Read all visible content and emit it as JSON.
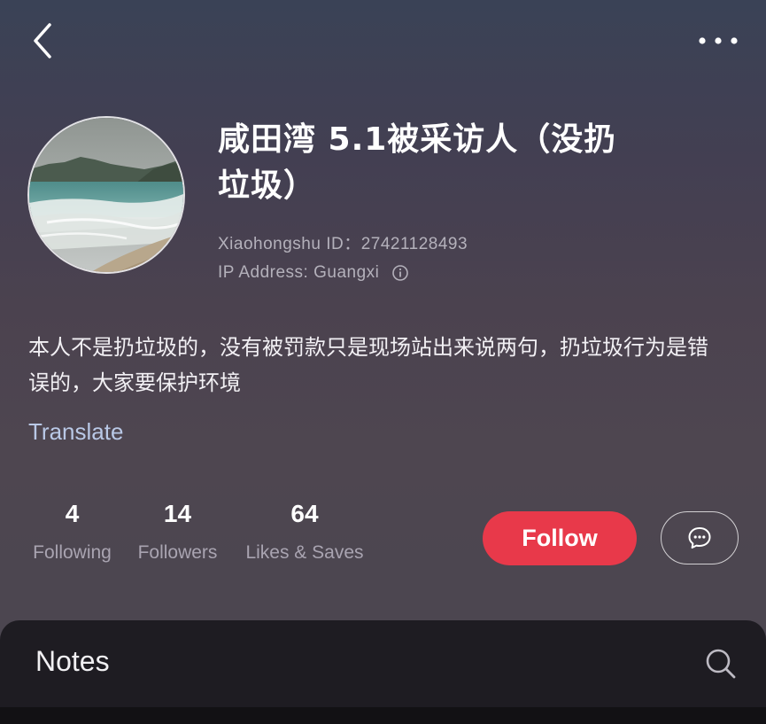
{
  "header": {
    "back_icon": "chevron-left-icon",
    "more_icon": "more-horizontal-icon"
  },
  "profile": {
    "name": "咸田湾 5.1被采访人（没扔垃圾）",
    "id_text": "Xiaohongshu ID：27421128493",
    "ip_text": "IP Address: Guangxi",
    "info_icon": "info-icon",
    "bio": "本人不是扔垃圾的，没有被罚款只是现场站出来说两句，扔垃圾行为是错误的，大家要保护环境",
    "translate_label": "Translate"
  },
  "stats": {
    "following": {
      "value": "4",
      "label": "Following"
    },
    "followers": {
      "value": "14",
      "label": "Followers"
    },
    "likes": {
      "value": "64",
      "label": "Likes & Saves"
    }
  },
  "actions": {
    "follow_label": "Follow",
    "message_icon": "chat-bubble-icon"
  },
  "notes": {
    "tab_label": "Notes",
    "search_icon": "search-icon"
  },
  "colors": {
    "follow_button": "#e8394a",
    "translate_link": "#b9c8e6",
    "panel": "#1e1c22"
  }
}
